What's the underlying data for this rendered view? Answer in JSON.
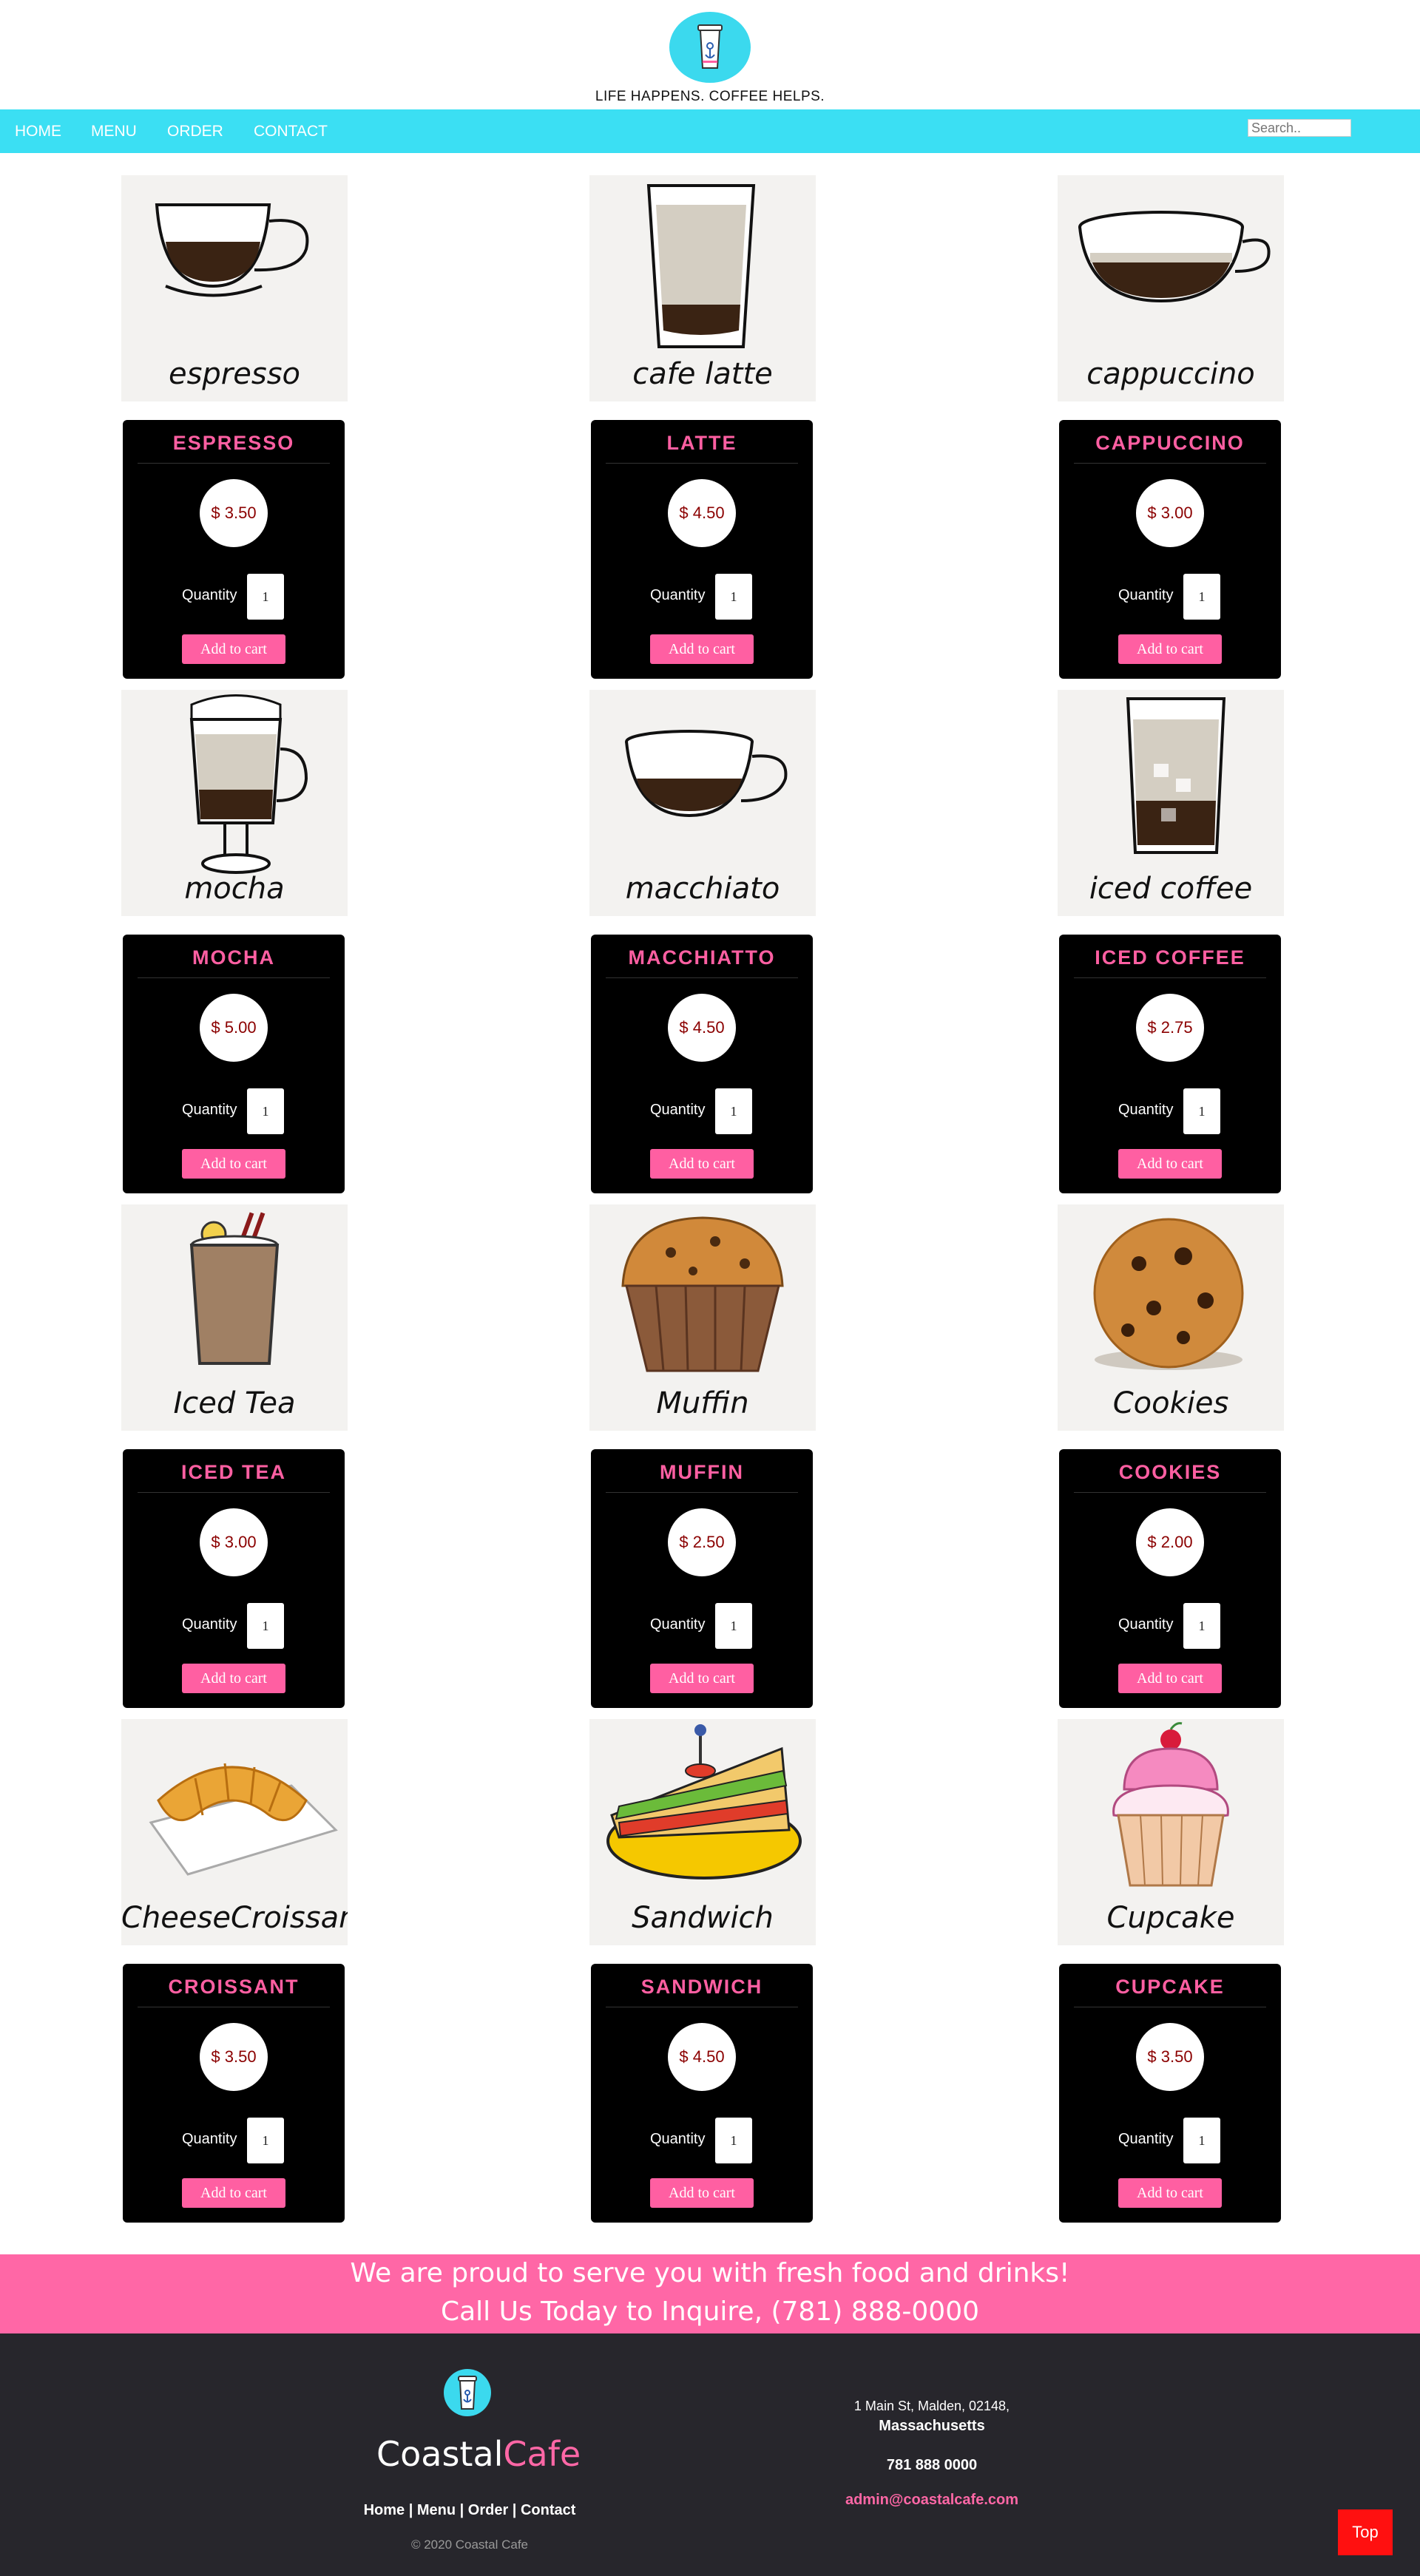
{
  "header": {
    "tagline": "LIFE HAPPENS. COFFEE HELPS.",
    "logo_icon": "coffee-cup-anchor-logo"
  },
  "nav": {
    "items": [
      "HOME",
      "MENU",
      "ORDER",
      "CONTACT"
    ],
    "search_placeholder": "Search.."
  },
  "menu": {
    "items": [
      {
        "title": "ESPRESSO",
        "price": "$ 3.50",
        "image_label": "espresso",
        "qty": "1"
      },
      {
        "title": "LATTE",
        "price": "$ 4.50",
        "image_label": "cafe latte",
        "qty": "1"
      },
      {
        "title": "CAPPUCCINO",
        "price": "$ 3.00",
        "image_label": "cappuccino",
        "qty": "1"
      },
      {
        "title": "MOCHA",
        "price": "$ 5.00",
        "image_label": "mocha",
        "qty": "1"
      },
      {
        "title": "MACCHIATTO",
        "price": "$ 4.50",
        "image_label": "macchiato",
        "qty": "1"
      },
      {
        "title": "ICED COFFEE",
        "price": "$ 2.75",
        "image_label": "iced coffee",
        "qty": "1"
      },
      {
        "title": "ICED TEA",
        "price": "$ 3.00",
        "image_label": "Iced Tea",
        "qty": "1"
      },
      {
        "title": "MUFFIN",
        "price": "$ 2.50",
        "image_label": "Muffin",
        "qty": "1"
      },
      {
        "title": "COOKIES",
        "price": "$ 2.00",
        "image_label": "Cookies",
        "qty": "1"
      },
      {
        "title": "CROISSANT",
        "price": "$ 3.50",
        "image_label": "CheeseCroissant",
        "qty": "1"
      },
      {
        "title": "SANDWICH",
        "price": "$ 4.50",
        "image_label": "Sandwich",
        "qty": "1"
      },
      {
        "title": "CUPCAKE",
        "price": "$ 3.50",
        "image_label": "Cupcake",
        "qty": "1"
      }
    ],
    "quantity_label": "Quantity",
    "add_label": "Add to cart"
  },
  "banner": {
    "line1": "We are proud to serve you with fresh food and drinks!",
    "line2": "Call Us Today to Inquire, (781) 888-0000"
  },
  "footer": {
    "brand_a": "Coastal",
    "brand_b": "Cafe",
    "links": "Home | Menu | Order | Contact",
    "copyright": "© 2020 Coastal Cafe",
    "address1": "1 Main St, Malden, 02148,",
    "address2": "Massachusetts",
    "phone": "781 888 0000",
    "email": "admin@coastalcafe.com"
  },
  "top_button": "Top",
  "colors": {
    "accent_pink": "#ff5fa2",
    "nav_cyan": "#3bdff3",
    "footer_dark": "#27262c",
    "price_red": "#8b0000"
  }
}
